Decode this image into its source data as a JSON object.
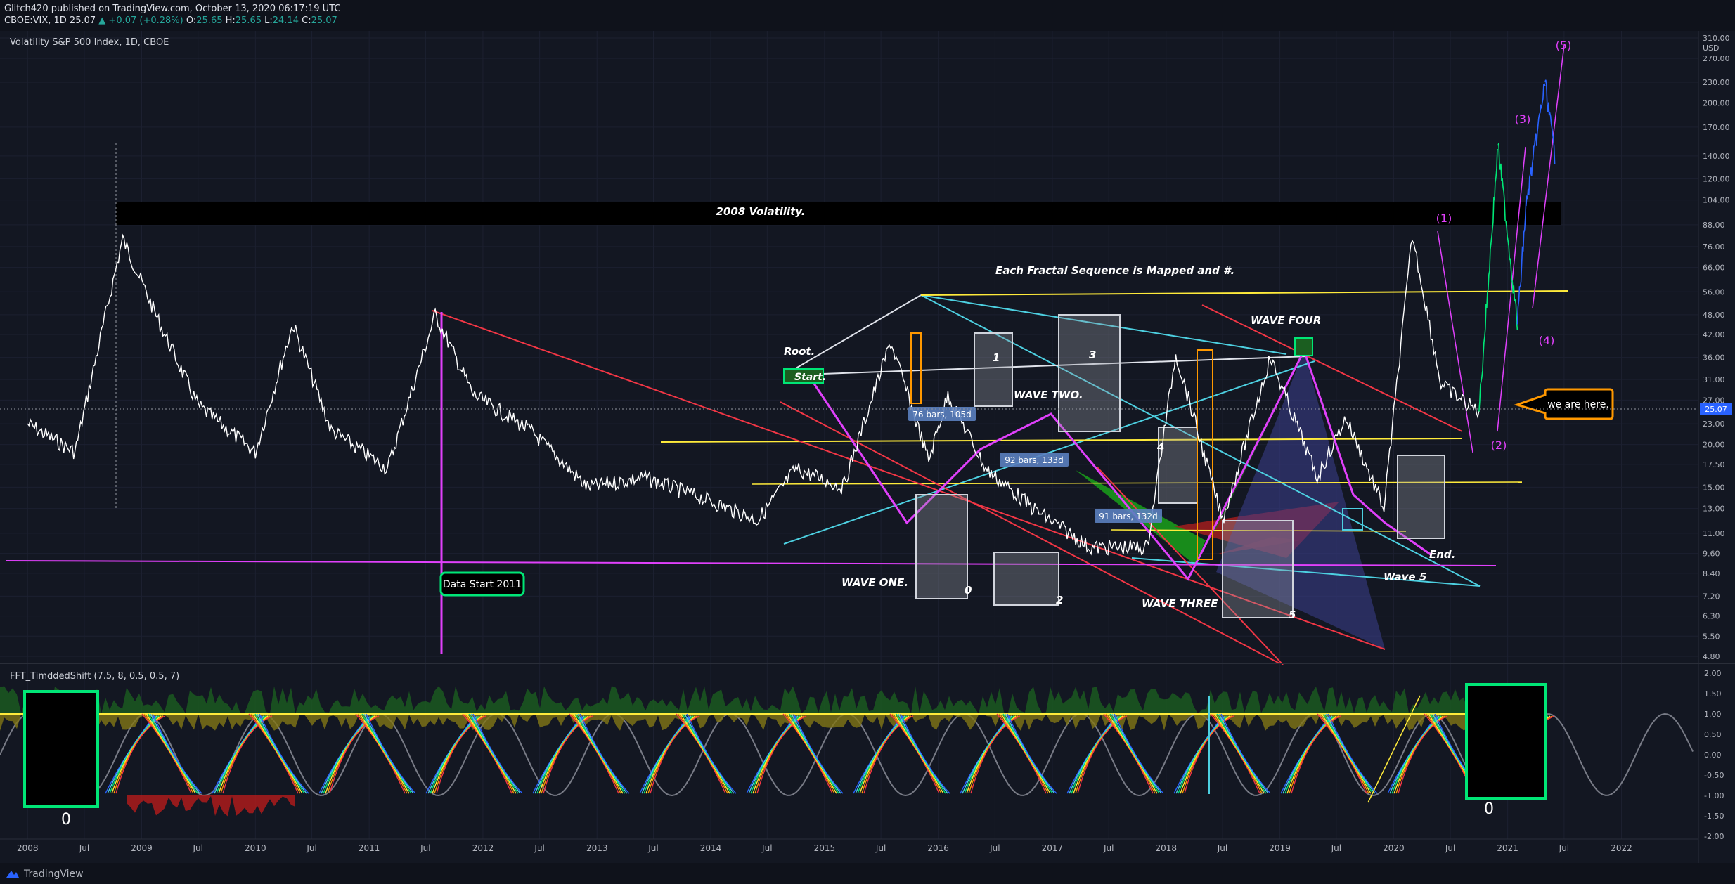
{
  "header": {
    "published_line": "Glitch420 published on TradingView.com, October 13, 2020 06:17:19 UTC",
    "symbol": "CBOE:VIX, 1D",
    "last": "25.07",
    "change": "+0.07 (+0.28%)",
    "open_label": "O:",
    "open": "25.65",
    "high_label": "H:",
    "high": "25.65",
    "low_label": "L:",
    "low": "24.14",
    "close_label": "C:",
    "close": "25.07"
  },
  "main_pane": {
    "title": "Volatility S&P 500 Index, 1D, CBOE",
    "currency": "USD",
    "price_ticks": [
      "310.00",
      "270.00",
      "230.00",
      "200.00",
      "170.00",
      "140.00",
      "120.00",
      "104.00",
      "88.00",
      "76.00",
      "66.00",
      "56.00",
      "48.00",
      "42.00",
      "36.00",
      "31.00",
      "27.00",
      "23.00",
      "20.00",
      "17.50",
      "15.00",
      "13.00",
      "11.00",
      "9.60",
      "8.40",
      "7.20",
      "6.30",
      "5.50",
      "4.80"
    ],
    "last_price_label": "25.07",
    "last_price_color": "#2962ff"
  },
  "indicator_pane": {
    "title": "FFT_TimddedShift (7.5, 8, 0.5, 0.5, 7)",
    "ticks": [
      "2.00",
      "1.50",
      "1.00",
      "0.50",
      "0.00",
      "-0.50",
      "-1.00",
      "-1.50",
      "-2.00"
    ],
    "label_zero_left": "0",
    "label_zero_right": "0"
  },
  "time_axis": {
    "labels": [
      "2008",
      "Jul",
      "2009",
      "Jul",
      "2010",
      "Jul",
      "2011",
      "Jul",
      "2012",
      "Jul",
      "2013",
      "Jul",
      "2014",
      "Jul",
      "2015",
      "Jul",
      "2016",
      "Jul",
      "2017",
      "Jul",
      "2018",
      "Jul",
      "2019",
      "Jul",
      "2020",
      "Jul",
      "2021",
      "Jul",
      "2022"
    ]
  },
  "annotations": {
    "band_2008": "2008 Volatility.",
    "fractal_note": "Each Fractal Sequence is Mapped and #.",
    "root": "Root.",
    "start": "Start.",
    "data_start": "Data Start 2011",
    "wave_one": "WAVE ONE.",
    "wave_two": "WAVE TWO.",
    "wave_three": "WAVE THREE",
    "wave_four": "WAVE FOUR",
    "wave_5": "Wave 5",
    "end": "End.",
    "we_are_here": "we are here.",
    "box_0": "0",
    "box_1": "1",
    "box_2": "2",
    "box_3": "3",
    "box_4": "4",
    "box_5": "5",
    "elliott_1": "(1)",
    "elliott_2": "(2)",
    "elliott_3": "(3)",
    "elliott_4": "(4)",
    "elliott_5": "(5)",
    "range_1": "76 bars, 105d",
    "range_2": "92 bars, 133d",
    "range_3": "91 bars, 132d"
  },
  "colors": {
    "background": "#131722",
    "price_line": "#ffffff",
    "magenta": "#e040fb",
    "yellow": "#ffeb3b",
    "red": "#f23645",
    "cyan": "#4dd0e1",
    "green": "#00e676",
    "orange": "#ff9800",
    "blue": "#2962ff"
  },
  "chart_data": {
    "type": "line",
    "scale": "log",
    "title": "Volatility S&P 500 Index, 1D, CBOE",
    "x": [
      "2008-01",
      "2008-06",
      "2008-10",
      "2008-11",
      "2009-03",
      "2009-07",
      "2010-01",
      "2010-05",
      "2010-09",
      "2011-03",
      "2011-08",
      "2011-12",
      "2012-06",
      "2012-12",
      "2013-06",
      "2013-12",
      "2014-06",
      "2014-10",
      "2015-03",
      "2015-08",
      "2015-12",
      "2016-02",
      "2016-06",
      "2016-11",
      "2017-05",
      "2017-11",
      "2018-02",
      "2018-07",
      "2018-12",
      "2019-05",
      "2019-08",
      "2019-12",
      "2020-03",
      "2020-06",
      "2020-09",
      "2020-10"
    ],
    "series": [
      {
        "values": [
          23,
          19,
          60,
          80,
          45,
          26,
          19,
          45,
          22,
          17,
          48,
          28,
          22,
          15,
          16,
          14,
          12,
          17,
          15,
          40,
          18,
          28,
          17,
          13,
          10,
          10,
          37,
          12,
          36,
          16,
          24,
          13,
          82,
          30,
          26,
          25.07
        ]
      }
    ],
    "projection": {
      "x": [
        "2020-10",
        "2020-12",
        "2021-02",
        "2021-03",
        "2021-05",
        "2021-06"
      ],
      "values": [
        25,
        150,
        45,
        100,
        230,
        140
      ]
    },
    "ylim": [
      4.8,
      310
    ]
  }
}
